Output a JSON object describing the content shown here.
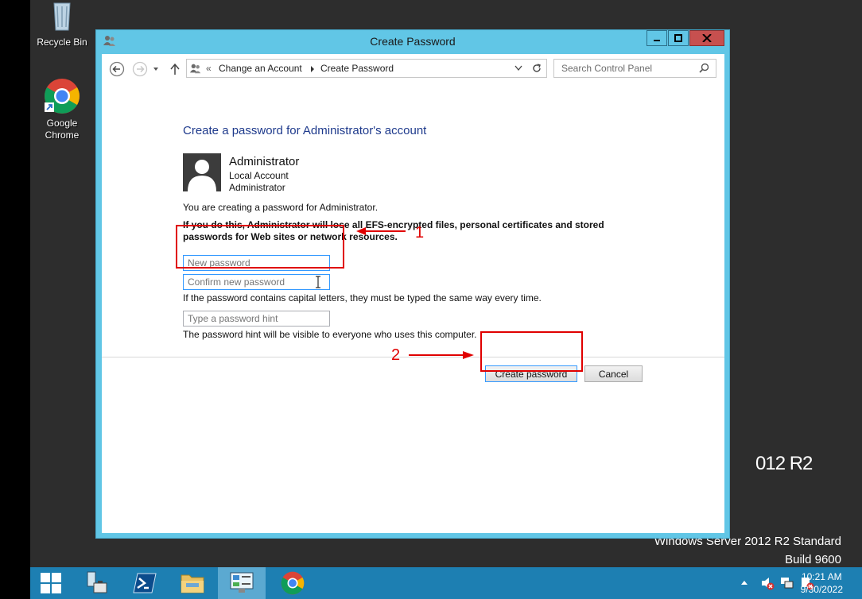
{
  "desktop": {
    "icons": [
      {
        "label": "Recycle Bin",
        "icon": "recycle-bin-icon"
      },
      {
        "label": "Google",
        "label2": "Chrome",
        "icon": "chrome-icon"
      }
    ],
    "brand_fragment": "012 R2",
    "edition_line1": "Windows Server 2012 R2 Standard",
    "edition_line2": "Build 9600"
  },
  "window": {
    "title": "Create Password",
    "controls": [
      "minimize",
      "maximize",
      "close"
    ],
    "accent_color": "#61c6e6"
  },
  "navbar": {
    "breadcrumb_prefix": "«",
    "breadcrumb": [
      "Change an Account",
      "Create Password"
    ],
    "search_placeholder": "Search Control Panel"
  },
  "content": {
    "heading": "Create a password for Administrator's account",
    "account": {
      "name": "Administrator",
      "type": "Local Account",
      "role": "Administrator"
    },
    "intro": "You are creating a password for Administrator.",
    "warning": "If you do this, Administrator will lose all EFS-encrypted files, personal certificates and stored passwords for Web sites or network resources.",
    "new_password_placeholder": "New password",
    "confirm_password_placeholder": "Confirm new password",
    "caps_note": "If the password contains capital letters, they must be typed the same way every time.",
    "hint_placeholder": "Type a password hint",
    "hint_note": "The password hint will be visible to everyone who uses this computer.",
    "create_button": "Create password",
    "cancel_button": "Cancel"
  },
  "annotations": {
    "color": "#e00000",
    "step1": "1",
    "step2": "2"
  },
  "taskbar": {
    "items": [
      "start",
      "server-manager",
      "powershell",
      "file-explorer",
      "control-panel",
      "chrome"
    ],
    "active": "control-panel",
    "time": "10:21 AM",
    "date": "9/30/2022"
  }
}
